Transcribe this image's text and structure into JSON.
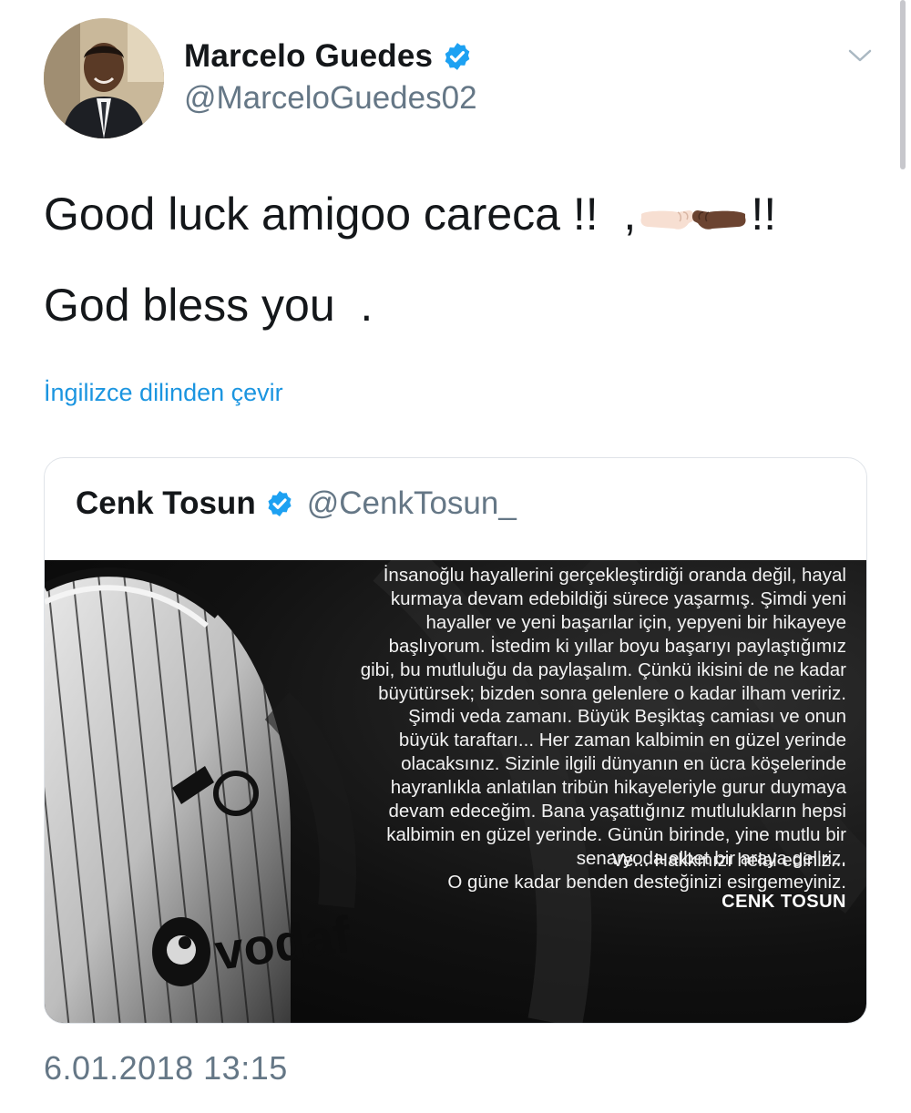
{
  "author": {
    "name": "Marcelo Guedes",
    "handle": "@MarceloGuedes02",
    "verified": true
  },
  "tweet": {
    "line1_start": "Good luck amigoo careca !!  ,",
    "line1_end": "!!",
    "line2": "God bless you  .",
    "emoji": "fist-bump-emoji"
  },
  "translate_link": "İngilizce dilinden çevir",
  "quoted_tweet": {
    "name": "Cenk Tosun",
    "handle": "@CenkTosun_",
    "verified": true,
    "image_text": {
      "lines": [
        "İnsanoğlu hayallerini gerçekleştirdiği oranda değil, hayal",
        "kurmaya devam edebildiği sürece yaşarmış. Şimdi yeni",
        "hayaller ve yeni başarılar için, yepyeni bir hikayeye",
        "başlıyorum. İstedim ki yıllar boyu başarıyı paylaştığımız",
        "gibi, bu mutluluğu da paylaşalım. Çünkü ikisini de ne kadar",
        "büyütürsek; bizden sonra gelenlere o kadar ilham veririz.",
        "Şimdi veda zamanı. Büyük Beşiktaş camiası ve onun",
        "büyük taraftarı... Her zaman kalbimin en güzel yerinde",
        "olacaksınız. Sizinle ilgili dünyanın en ücra köşelerinde",
        "hayranlıkla anlatılan tribün hikayeleriyle gurur duymaya",
        "devam edeceğim. Bana yaşattığınız mutlulukların hepsi",
        "kalbimin en güzel yerinde. Günün birinde, yine mutlu bir",
        "senaryoda elbet bir araya geliriz.",
        "O güne kadar benden desteğinizi esirgemeyiniz."
      ],
      "closing": "Ve... Hakkınızı helal ediniz...",
      "signature": "CENK TOSUN"
    }
  },
  "timestamp": "6.01.2018 13:15",
  "colors": {
    "text": "#14171a",
    "secondary": "#657786",
    "link": "#1b95e0",
    "verified": "#1da1f2",
    "border": "#dfe3e8"
  }
}
